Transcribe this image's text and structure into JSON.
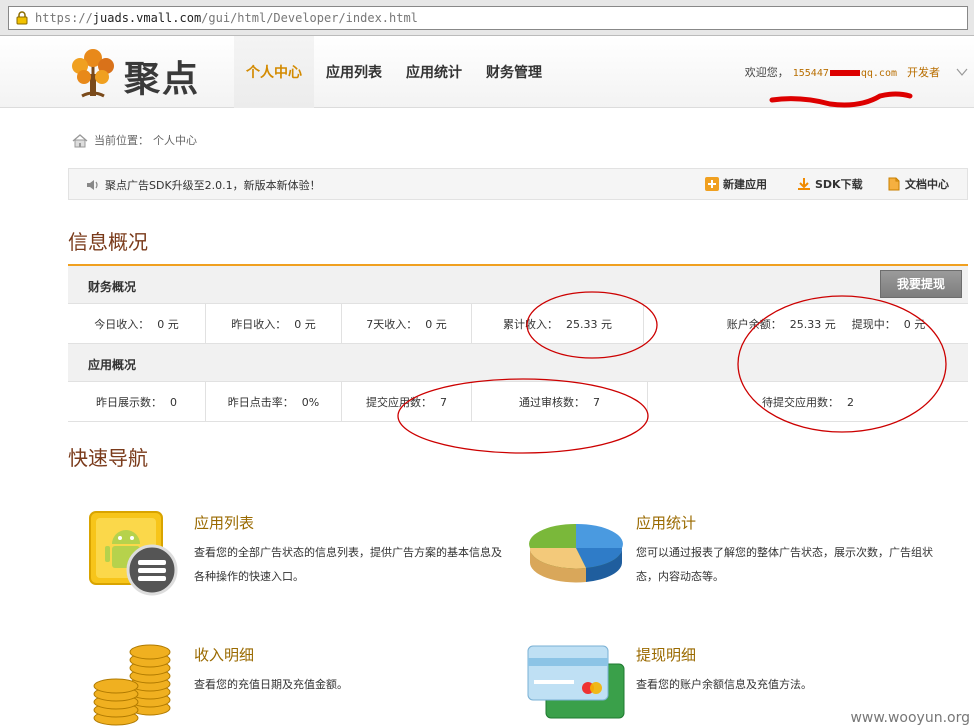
{
  "browser": {
    "url_prefix": "https://",
    "url_domain": "juads.vmall.com",
    "url_path": "/gui/html/Developer/index.html"
  },
  "header": {
    "logo_text": "聚点",
    "nav": [
      "个人中心",
      "应用列表",
      "应用统计",
      "财务管理"
    ],
    "welcome_label": "欢迎您，",
    "account": "155447",
    "account_tail": "qq.com",
    "role": "开发者"
  },
  "breadcrumb": {
    "label": "当前位置：",
    "current": "个人中心"
  },
  "notice": {
    "message": "聚点广告SDK升级至2.0.1，新版本新体验！",
    "actions": [
      "新建应用",
      "SDK下载",
      "文档中心"
    ]
  },
  "overview": {
    "title": "信息概况",
    "finance": {
      "title": "财务概况",
      "withdraw_button": "我要提现",
      "today_label": "今日收入：",
      "today_value": "0 元",
      "yesterday_label": "昨日收入：",
      "yesterday_value": "0 元",
      "week_label": "7天收入：",
      "week_value": "0 元",
      "total_label": "累计收入：",
      "total_value": "25.33 元",
      "balance_label": "账户余额：",
      "balance_value": "25.33 元",
      "pending_label": "提现中：",
      "pending_value": "0 元"
    },
    "apps": {
      "title": "应用概况",
      "impressions_label": "昨日展示数：",
      "impressions_value": "0",
      "ctr_label": "昨日点击率：",
      "ctr_value": "0%",
      "submitted_label": "提交应用数：",
      "submitted_value": "7",
      "approved_label": "通过审核数：",
      "approved_value": "7",
      "to_submit_label": "待提交应用数：",
      "to_submit_value": "2"
    }
  },
  "quicknav": {
    "title": "快速导航",
    "items": [
      {
        "title": "应用列表",
        "desc": "查看您的全部广告状态的信息列表，提供广告方案的基本信息及各种操作的快速入口。",
        "icon": "android-list-icon"
      },
      {
        "title": "应用统计",
        "desc": "您可以通过报表了解您的整体广告状态，展示次数，广告组状态，内容动态等。",
        "icon": "pie-chart-icon"
      },
      {
        "title": "收入明细",
        "desc": "查看您的充值日期及充值金额。",
        "icon": "gold-coins-icon"
      },
      {
        "title": "提现明细",
        "desc": "查看您的账户余额信息及充值方法。",
        "icon": "credit-card-icon"
      }
    ]
  },
  "watermark": "www.wooyun.org",
  "colors": {
    "accent": "#d38a00",
    "overview_border": "#f0a020",
    "section_title": "#7a3a1a",
    "annotation": "#cc0000"
  }
}
